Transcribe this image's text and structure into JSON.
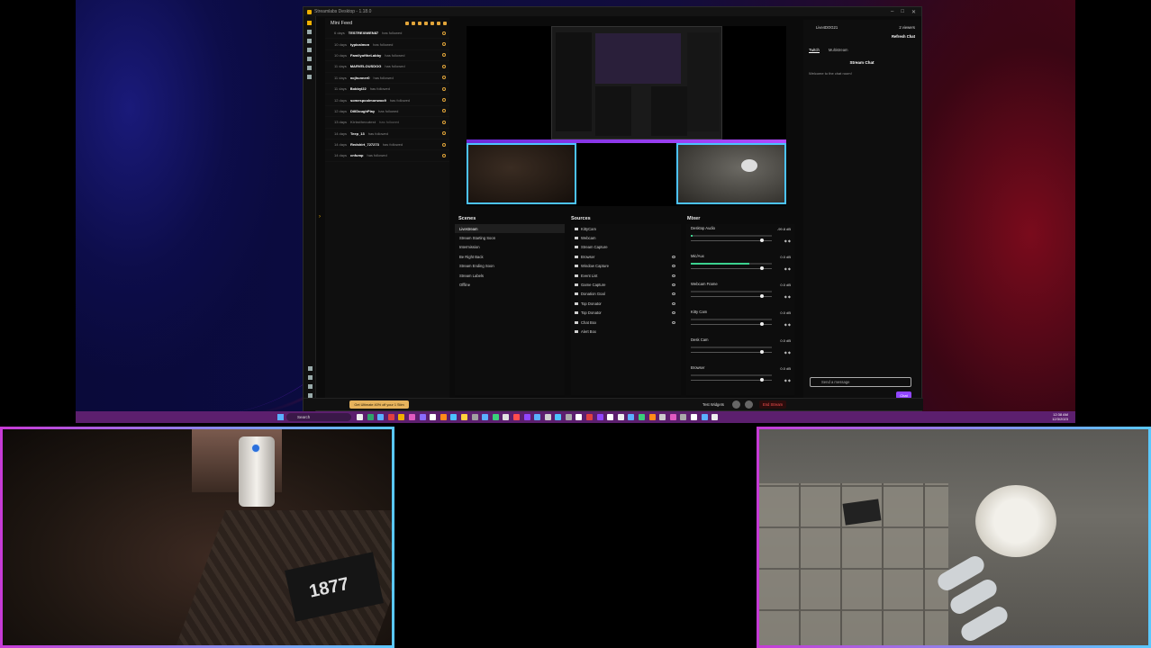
{
  "app": {
    "title": "Streamlabs Desktop - 1.18.0",
    "mini_feed": {
      "title": "Mini Feed",
      "rows": [
        {
          "time": "6 days",
          "user": "TESTREXIWEN87",
          "action": "has followed",
          "dim": false
        },
        {
          "time": "10 days",
          "user": "typicalmon",
          "action": "has followed",
          "dim": false
        },
        {
          "time": "10 days",
          "user": "FamilyoftheLabby",
          "action": "has followed",
          "dim": false
        },
        {
          "time": "11 days",
          "user": "MARVELOUSDOG",
          "action": "has followed",
          "dim": false
        },
        {
          "time": "11 days",
          "user": "nojhunner0",
          "action": "has followed",
          "dim": false
        },
        {
          "time": "11 days",
          "user": "Bobbyl22",
          "action": "has followed",
          "dim": false
        },
        {
          "time": "12 days",
          "user": "somespoolmonwoo9",
          "action": "has followed",
          "dim": false
        },
        {
          "time": "12 days",
          "user": "DillDoughPlay",
          "action": "has followed",
          "dim": false
        },
        {
          "time": "13 days",
          "user": "Kirbsthecutest",
          "action": "has followed",
          "dim": true
        },
        {
          "time": "14 days",
          "user": "Teep_13",
          "action": "has followed",
          "dim": false
        },
        {
          "time": "14 days",
          "user": "Redshirt_727273",
          "action": "has followed",
          "dim": false
        },
        {
          "time": "14 days",
          "user": "cnfump",
          "action": "has followed",
          "dim": false
        }
      ]
    },
    "scenes": {
      "title": "Scenes",
      "items": [
        "Livestream",
        "Stream Starting Soon",
        "Intermission",
        "Be Right Back",
        "Stream Ending Soon",
        "Stream Labels",
        "Offline"
      ]
    },
    "sources": {
      "title": "Sources",
      "items": [
        "KittyCam",
        "Webcam",
        "Stream Capture",
        "Browser",
        "Window Capture",
        "Event List",
        "Game Capture",
        "Donation Goal",
        "Top Donator",
        "Top Donator",
        "Chat Box",
        "Alert Box"
      ]
    },
    "mixer": {
      "title": "Mixer",
      "channels": [
        {
          "name": "Desktop Audio",
          "db": "-99.8 dB",
          "level": 0.02,
          "fader": 0.88
        },
        {
          "name": "Mic/Aux",
          "db": "0.0 dB",
          "level": 0.72,
          "fader": 0.88
        },
        {
          "name": "Webcam Frame",
          "db": "0.0 dB",
          "level": 0,
          "fader": 0.88
        },
        {
          "name": "Kitty Cam",
          "db": "0.0 dB",
          "level": 0,
          "fader": 0.88
        },
        {
          "name": "Desk Cam",
          "db": "0.0 dB",
          "level": 0,
          "fader": 0.88
        },
        {
          "name": "Browser",
          "db": "0.0 dB",
          "level": 0,
          "fader": 0.88
        }
      ]
    },
    "bottom": {
      "promo": "Get Ultimate 40% off your 1 Stim",
      "test_widgets": "Test Widgets",
      "end_stream": "End Stream"
    },
    "chat": {
      "user": "Live4DOG21",
      "viewers": "2 viewers",
      "refresh": "Refresh Chat",
      "tabs": [
        "Twitch",
        "Multistream"
      ],
      "title": "Stream Chat",
      "welcome": "Welcome to the chat room!",
      "placeholder": "Send a message",
      "send": "Chat"
    }
  },
  "taskbar": {
    "search": "Search",
    "time": "12:38 AM",
    "date": "12/3/2023",
    "icon_colors": [
      "#eeeeee",
      "#2fa36b",
      "#5ab0ff",
      "#e04040",
      "#f0b000",
      "#e05ac0",
      "#8a6cff",
      "#ffffff",
      "#ff8c1a",
      "#4cc3ff",
      "#ffd23c",
      "#a0a0a0",
      "#5ab0ff",
      "#3ad07a",
      "#e0e0e0",
      "#ff4d4d",
      "#9146ff",
      "#5ab0ff",
      "#d0d0d0",
      "#4cc3ff",
      "#aaaaaa",
      "#ffffff",
      "#e04040",
      "#9146ff",
      "#ffffff",
      "#eeeeee",
      "#5ab0ff",
      "#3ad07a",
      "#ff8c1a",
      "#cccccc",
      "#e05ac0",
      "#aaaaaa",
      "#ffffff",
      "#5ab0ff",
      "#eeeeee"
    ]
  },
  "webcam_box_text": "1877"
}
